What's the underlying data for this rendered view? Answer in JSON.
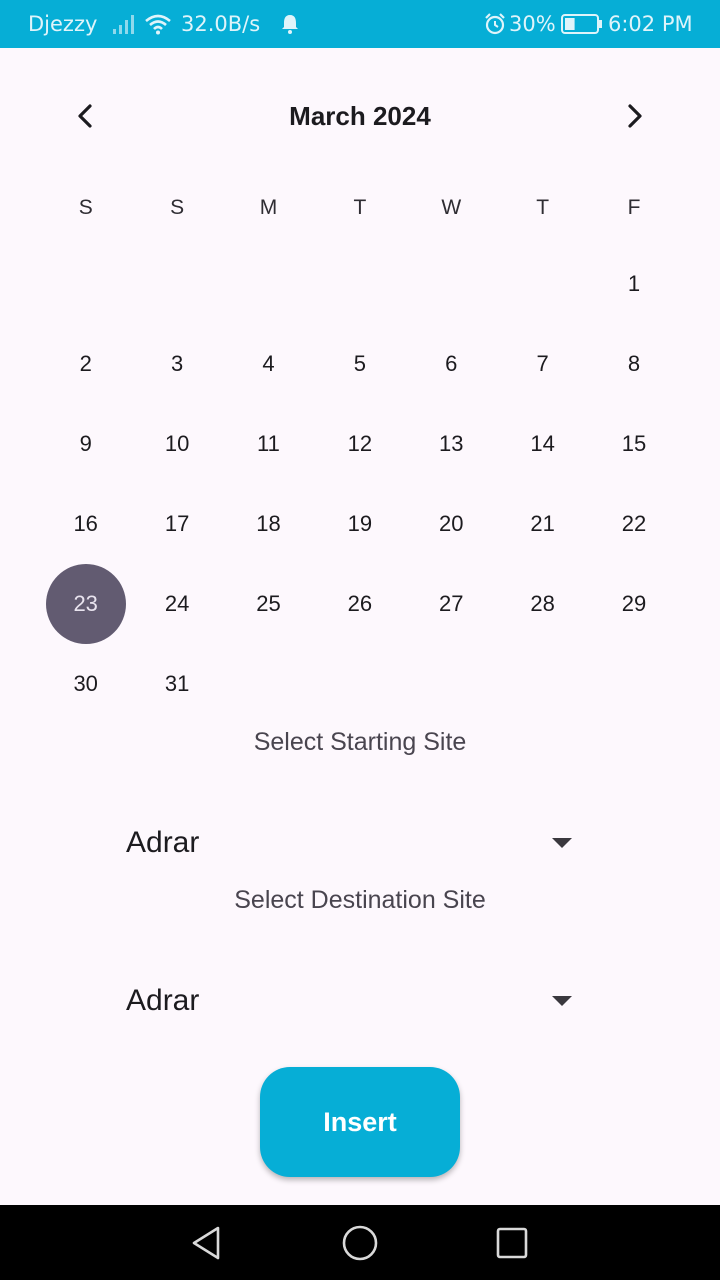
{
  "status_bar": {
    "carrier": "Djezzy",
    "network_speed": "32.0B/s",
    "battery": "30%",
    "battery_level": 0.3,
    "time": "6:02 PM",
    "icons": [
      "signal-icon",
      "wifi-icon",
      "bell-icon",
      "alarm-icon",
      "battery-icon"
    ]
  },
  "calendar": {
    "month_title": "March 2024",
    "weekdays": [
      "S",
      "S",
      "M",
      "T",
      "W",
      "T",
      "F"
    ],
    "leading_blanks": 6,
    "days_in_month": 31,
    "selected_day": "23"
  },
  "start_site": {
    "label": "Select Starting Site",
    "value": "Adrar"
  },
  "destination_site": {
    "label": "Select Destination Site",
    "value": "Adrar"
  },
  "actions": {
    "insert_label": "Insert"
  },
  "colors": {
    "accent": "#06aed6",
    "selected_day": "#625b71",
    "background": "#fdf8fd"
  }
}
